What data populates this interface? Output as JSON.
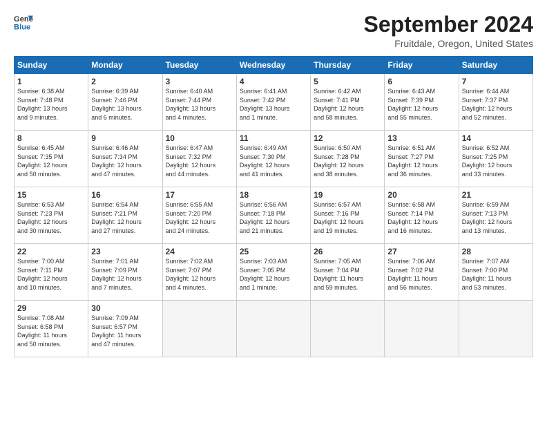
{
  "header": {
    "logo_line1": "General",
    "logo_line2": "Blue",
    "month_title": "September 2024",
    "location": "Fruitdale, Oregon, United States"
  },
  "weekdays": [
    "Sunday",
    "Monday",
    "Tuesday",
    "Wednesday",
    "Thursday",
    "Friday",
    "Saturday"
  ],
  "weeks": [
    [
      {
        "day": "1",
        "info": "Sunrise: 6:38 AM\nSunset: 7:48 PM\nDaylight: 13 hours\nand 9 minutes."
      },
      {
        "day": "2",
        "info": "Sunrise: 6:39 AM\nSunset: 7:46 PM\nDaylight: 13 hours\nand 6 minutes."
      },
      {
        "day": "3",
        "info": "Sunrise: 6:40 AM\nSunset: 7:44 PM\nDaylight: 13 hours\nand 4 minutes."
      },
      {
        "day": "4",
        "info": "Sunrise: 6:41 AM\nSunset: 7:42 PM\nDaylight: 13 hours\nand 1 minute."
      },
      {
        "day": "5",
        "info": "Sunrise: 6:42 AM\nSunset: 7:41 PM\nDaylight: 12 hours\nand 58 minutes."
      },
      {
        "day": "6",
        "info": "Sunrise: 6:43 AM\nSunset: 7:39 PM\nDaylight: 12 hours\nand 55 minutes."
      },
      {
        "day": "7",
        "info": "Sunrise: 6:44 AM\nSunset: 7:37 PM\nDaylight: 12 hours\nand 52 minutes."
      }
    ],
    [
      {
        "day": "8",
        "info": "Sunrise: 6:45 AM\nSunset: 7:35 PM\nDaylight: 12 hours\nand 50 minutes."
      },
      {
        "day": "9",
        "info": "Sunrise: 6:46 AM\nSunset: 7:34 PM\nDaylight: 12 hours\nand 47 minutes."
      },
      {
        "day": "10",
        "info": "Sunrise: 6:47 AM\nSunset: 7:32 PM\nDaylight: 12 hours\nand 44 minutes."
      },
      {
        "day": "11",
        "info": "Sunrise: 6:49 AM\nSunset: 7:30 PM\nDaylight: 12 hours\nand 41 minutes."
      },
      {
        "day": "12",
        "info": "Sunrise: 6:50 AM\nSunset: 7:28 PM\nDaylight: 12 hours\nand 38 minutes."
      },
      {
        "day": "13",
        "info": "Sunrise: 6:51 AM\nSunset: 7:27 PM\nDaylight: 12 hours\nand 36 minutes."
      },
      {
        "day": "14",
        "info": "Sunrise: 6:52 AM\nSunset: 7:25 PM\nDaylight: 12 hours\nand 33 minutes."
      }
    ],
    [
      {
        "day": "15",
        "info": "Sunrise: 6:53 AM\nSunset: 7:23 PM\nDaylight: 12 hours\nand 30 minutes."
      },
      {
        "day": "16",
        "info": "Sunrise: 6:54 AM\nSunset: 7:21 PM\nDaylight: 12 hours\nand 27 minutes."
      },
      {
        "day": "17",
        "info": "Sunrise: 6:55 AM\nSunset: 7:20 PM\nDaylight: 12 hours\nand 24 minutes."
      },
      {
        "day": "18",
        "info": "Sunrise: 6:56 AM\nSunset: 7:18 PM\nDaylight: 12 hours\nand 21 minutes."
      },
      {
        "day": "19",
        "info": "Sunrise: 6:57 AM\nSunset: 7:16 PM\nDaylight: 12 hours\nand 19 minutes."
      },
      {
        "day": "20",
        "info": "Sunrise: 6:58 AM\nSunset: 7:14 PM\nDaylight: 12 hours\nand 16 minutes."
      },
      {
        "day": "21",
        "info": "Sunrise: 6:59 AM\nSunset: 7:13 PM\nDaylight: 12 hours\nand 13 minutes."
      }
    ],
    [
      {
        "day": "22",
        "info": "Sunrise: 7:00 AM\nSunset: 7:11 PM\nDaylight: 12 hours\nand 10 minutes."
      },
      {
        "day": "23",
        "info": "Sunrise: 7:01 AM\nSunset: 7:09 PM\nDaylight: 12 hours\nand 7 minutes."
      },
      {
        "day": "24",
        "info": "Sunrise: 7:02 AM\nSunset: 7:07 PM\nDaylight: 12 hours\nand 4 minutes."
      },
      {
        "day": "25",
        "info": "Sunrise: 7:03 AM\nSunset: 7:05 PM\nDaylight: 12 hours\nand 1 minute."
      },
      {
        "day": "26",
        "info": "Sunrise: 7:05 AM\nSunset: 7:04 PM\nDaylight: 11 hours\nand 59 minutes."
      },
      {
        "day": "27",
        "info": "Sunrise: 7:06 AM\nSunset: 7:02 PM\nDaylight: 11 hours\nand 56 minutes."
      },
      {
        "day": "28",
        "info": "Sunrise: 7:07 AM\nSunset: 7:00 PM\nDaylight: 11 hours\nand 53 minutes."
      }
    ],
    [
      {
        "day": "29",
        "info": "Sunrise: 7:08 AM\nSunset: 6:58 PM\nDaylight: 11 hours\nand 50 minutes."
      },
      {
        "day": "30",
        "info": "Sunrise: 7:09 AM\nSunset: 6:57 PM\nDaylight: 11 hours\nand 47 minutes."
      },
      {
        "day": "",
        "info": ""
      },
      {
        "day": "",
        "info": ""
      },
      {
        "day": "",
        "info": ""
      },
      {
        "day": "",
        "info": ""
      },
      {
        "day": "",
        "info": ""
      }
    ]
  ]
}
